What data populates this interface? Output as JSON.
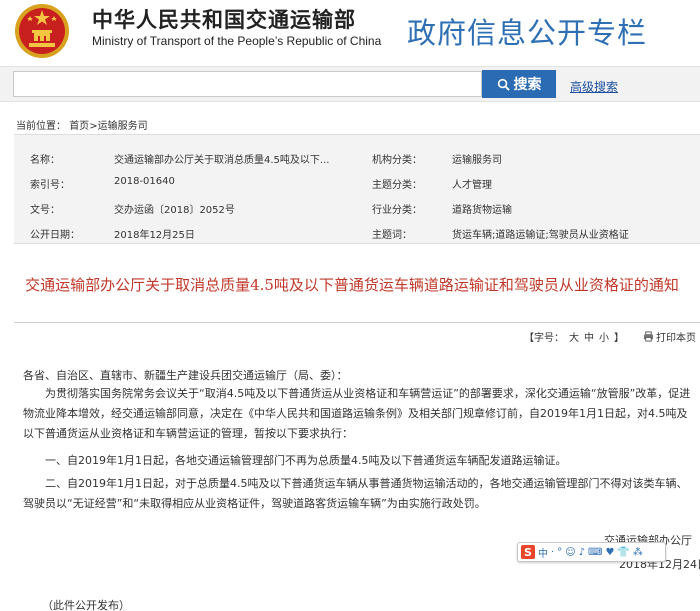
{
  "header": {
    "cn_name": "中华人民共和国交通运输部",
    "en_name": "Ministry of Transport of the People’s Republic of China",
    "site_title": "政府信息公开专栏"
  },
  "search": {
    "placeholder": "",
    "button_label": "搜索",
    "advanced_label": "高级搜索"
  },
  "breadcrumb": {
    "prefix": "当前位置：",
    "home": "首页",
    "sep": ">",
    "section": "运输服务司"
  },
  "meta": {
    "rows": [
      {
        "k1": "名称：",
        "v1": "交通运输部办公厅关于取消总质量4.5吨及以下...",
        "k2": "机构分类：",
        "v2": "运输服务司"
      },
      {
        "k1": "索引号：",
        "v1": "2018-01640",
        "k2": "主题分类：",
        "v2": "人才管理"
      },
      {
        "k1": "文号：",
        "v1": "交办运函〔2018〕2052号",
        "k2": "行业分类：",
        "v2": "道路货物运输"
      },
      {
        "k1": "公开日期：",
        "v1": "2018年12月25日",
        "k2": "主题词：",
        "v2": "货运车辆;道路运输证;驾驶员从业资格证"
      }
    ]
  },
  "article": {
    "title": "交通运输部办公厅关于取消总质量4.5吨及以下普通货运车辆道路运输证和驾驶员从业资格证的通知",
    "font_ctrl": {
      "label": "【字号：",
      "large": "大",
      "medium": "中",
      "small": "小",
      "end": "】"
    },
    "print_label": "打印本页",
    "salutation": "各省、自治区、直辖市、新疆生产建设兵团交通运输厅（局、委）：",
    "para1": "为贯彻落实国务院常务会议关于“取消4.5吨及以下普通货运从业资格证和车辆营运证”的部署要求，深化交通运输“放管服”改革，促进物流业降本增效，经交通运输部同意，决定在《中华人民共和国道路运输条例》及相关部门规章修订前，自2019年1月1日起，对4.5吨及以下普通货运从业资格证和车辆营运证的管理，暂按以下要求执行：",
    "para2": "一、自2019年1月1日起，各地交通运输管理部门不再为总质量4.5吨及以下普通货运车辆配发道路运输证。",
    "para3": "二、自2019年1月1日起，对于总质量4.5吨及以下普通货运车辆从事普通货物运输活动的，各地交通运输管理部门不得对该类车辆、驾驶员以“无证经营”和“未取得相应从业资格证件，驾驶道路客货运输车辆”为由实施行政处罚。",
    "sign_org": "交通运输部办公厅",
    "sign_date": "2018年12月24日",
    "footnote": "（此件公开发布）"
  },
  "ime": {
    "logo": "S",
    "items": [
      "中",
      "·",
      "°",
      "☺",
      "♪",
      "⌨",
      "♥",
      "👕",
      "⁂"
    ]
  },
  "colors": {
    "accent": "#2f6fb4",
    "title_red": "#c0392b",
    "search_btn": "#2a6bb3"
  }
}
